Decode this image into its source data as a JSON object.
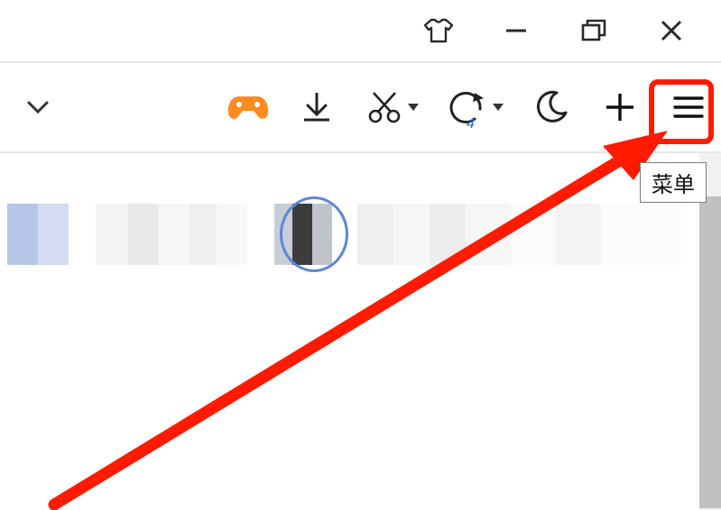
{
  "window_controls": {
    "customize_icon": "tshirt-icon",
    "minimize_icon": "minimize-icon",
    "maximize_icon": "maximize-restore-icon",
    "close_icon": "close-icon"
  },
  "toolbar": {
    "dropdown_icon": "chevron-down-icon",
    "game_icon": "game-controller-icon",
    "download_icon": "download-icon",
    "screenshot_icon": "scissors-icon",
    "refresh_icon": "undo-refresh-icon",
    "refresh_count": "4",
    "night_mode_icon": "moon-icon",
    "add_icon": "plus-icon",
    "menu_icon": "hamburger-menu-icon"
  },
  "tooltip": {
    "text": "菜单"
  },
  "annotation": {
    "arrow_color": "#ff1a00",
    "highlight_color": "#ff1a00"
  }
}
